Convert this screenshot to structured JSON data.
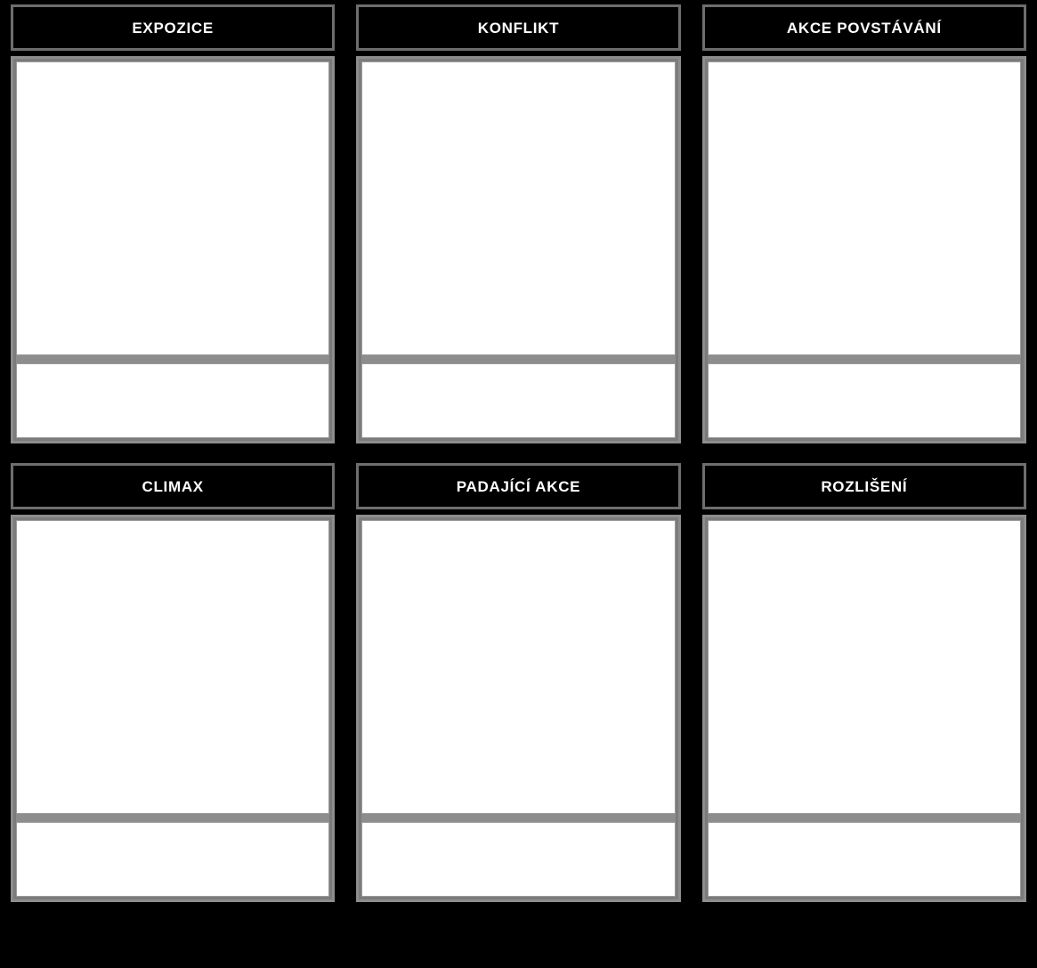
{
  "template": {
    "title": "Plot Diagram Storyboard",
    "colors": {
      "background": "#000000",
      "header_bg": "#000000",
      "header_text": "#ffffff",
      "header_border": "#6e6e6e",
      "panel_frame": "#8d8d8d",
      "panel_inner": "#7b7b7b",
      "cell_bg": "#ffffff",
      "cell_border": "#9a9a9a"
    }
  },
  "rows": [
    {
      "row_index": 1,
      "panels": [
        {
          "header": "EXPOZICE",
          "image_text": "",
          "caption_text": ""
        },
        {
          "header": "KONFLIKT",
          "image_text": "",
          "caption_text": ""
        },
        {
          "header": "AKCE POVSTÁVÁNÍ",
          "image_text": "",
          "caption_text": ""
        }
      ]
    },
    {
      "row_index": 2,
      "panels": [
        {
          "header": "CLIMAX",
          "image_text": "",
          "caption_text": ""
        },
        {
          "header": "PADAJÍCÍ AKCE",
          "image_text": "",
          "caption_text": ""
        },
        {
          "header": "ROZLIŠENÍ",
          "image_text": "",
          "caption_text": ""
        }
      ]
    }
  ]
}
